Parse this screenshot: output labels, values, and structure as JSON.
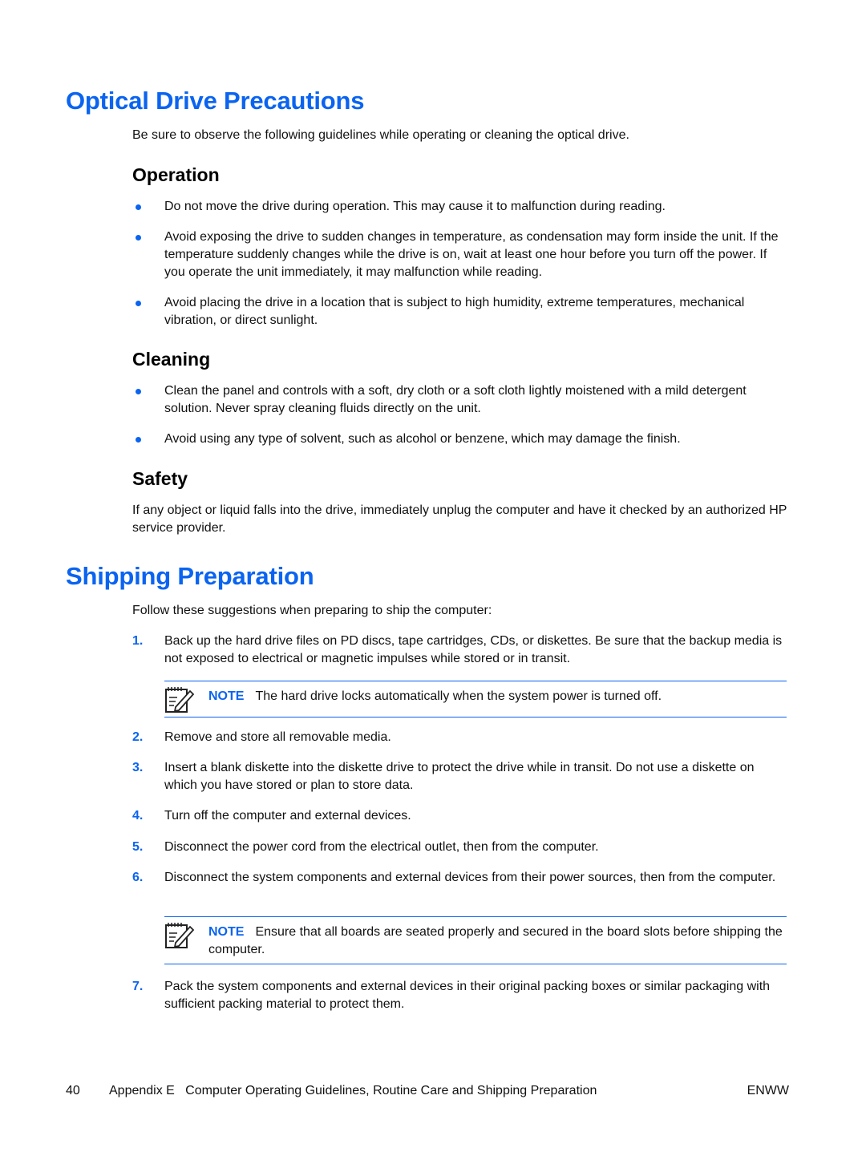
{
  "section1": {
    "title": "Optical Drive Precautions",
    "intro": "Be sure to observe the following guidelines while operating or cleaning the optical drive.",
    "operation": {
      "heading": "Operation",
      "items": [
        "Do not move the drive during operation. This may cause it to malfunction during reading.",
        "Avoid exposing the drive to sudden changes in temperature, as condensation may form inside the unit. If the temperature suddenly changes while the drive is on, wait at least one hour before you turn off the power. If you operate the unit immediately, it may malfunction while reading.",
        "Avoid placing the drive in a location that is subject to high humidity, extreme temperatures, mechanical vibration, or direct sunlight."
      ]
    },
    "cleaning": {
      "heading": "Cleaning",
      "items": [
        "Clean the panel and controls with a soft, dry cloth or a soft cloth lightly moistened with a mild detergent solution. Never spray cleaning fluids directly on the unit.",
        "Avoid using any type of solvent, such as alcohol or benzene, which may damage the finish."
      ]
    },
    "safety": {
      "heading": "Safety",
      "text": "If any object or liquid falls into the drive, immediately unplug the computer and have it checked by an authorized HP service provider."
    }
  },
  "section2": {
    "title": "Shipping Preparation",
    "intro": "Follow these suggestions when preparing to ship the computer:",
    "steps": [
      {
        "num": "1.",
        "text": "Back up the hard drive files on PD discs, tape cartridges, CDs, or diskettes. Be sure that the backup media is not exposed to electrical or magnetic impulses while stored or in transit."
      },
      {
        "num": "2.",
        "text": "Remove and store all removable media."
      },
      {
        "num": "3.",
        "text": "Insert a blank diskette into the diskette drive to protect the drive while in transit. Do not use a diskette on which you have stored or plan to store data."
      },
      {
        "num": "4.",
        "text": "Turn off the computer and external devices."
      },
      {
        "num": "5.",
        "text": "Disconnect the power cord from the electrical outlet, then from the computer."
      },
      {
        "num": "6.",
        "text": "Disconnect the system components and external devices from their power sources, then from the computer."
      },
      {
        "num": "7.",
        "text": "Pack the system components and external devices in their original packing boxes or similar packaging with sufficient packing material to protect them."
      }
    ],
    "notes": [
      {
        "label": "NOTE",
        "text": "The hard drive locks automatically when the system power is turned off."
      },
      {
        "label": "NOTE",
        "text": "Ensure that all boards are seated properly and secured in the board slots before shipping the computer."
      }
    ]
  },
  "footer": {
    "page_number": "40",
    "chapter": "Appendix E   Computer Operating Guidelines, Routine Care and Shipping Preparation",
    "locale": "ENWW"
  },
  "colors": {
    "accent": "#0a64f0",
    "text": "#111111"
  }
}
